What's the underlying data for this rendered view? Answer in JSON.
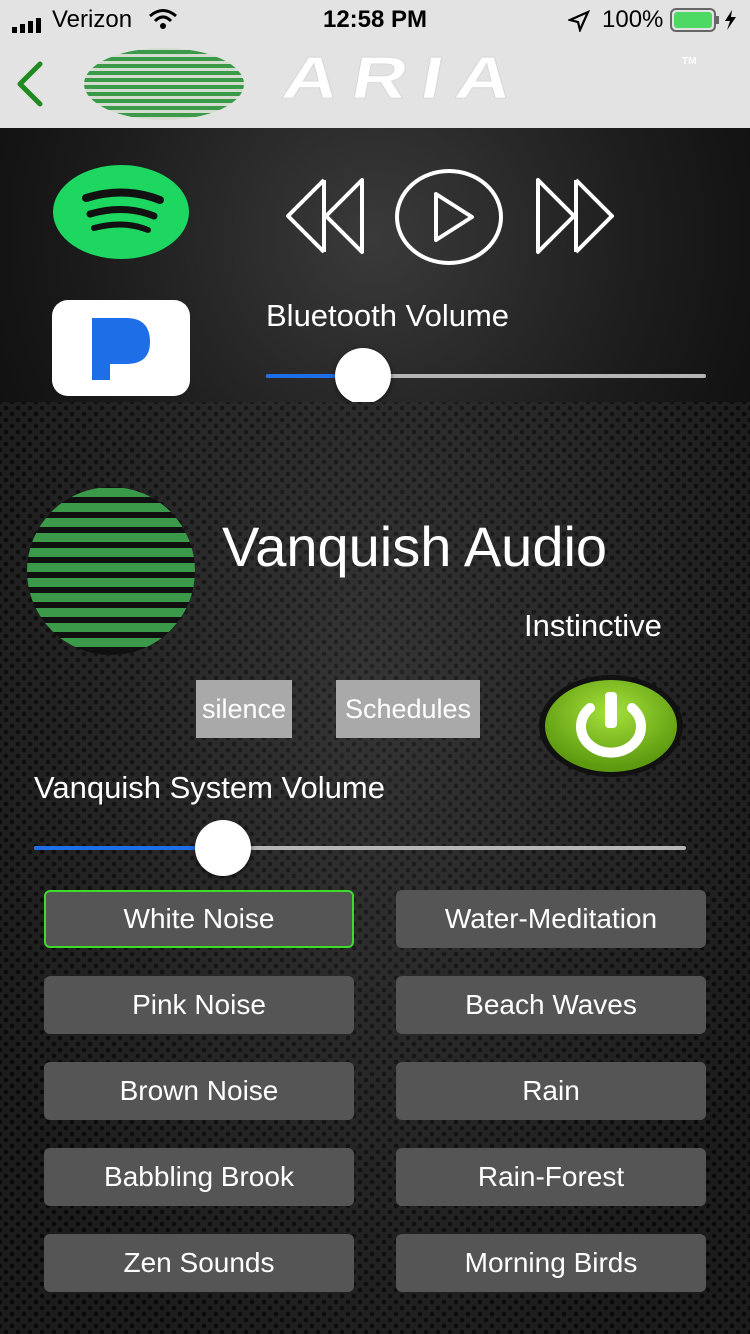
{
  "status_bar": {
    "carrier": "Verizon",
    "time": "12:58 PM",
    "battery": "100%"
  },
  "header": {
    "brand": "ARIA",
    "tm": "TM"
  },
  "media": {
    "bluetooth_volume_label": "Bluetooth Volume",
    "bluetooth_volume_level": 0.22
  },
  "device": {
    "name": "Vanquish Audio",
    "mode": "Instinctive",
    "silence_label": "silence",
    "schedules_label": "Schedules",
    "system_volume_label": "Vanquish System Volume",
    "system_volume_level": 0.29
  },
  "sounds": {
    "left": [
      "White Noise",
      "Pink Noise",
      "Brown Noise",
      "Babbling Brook",
      "Zen Sounds"
    ],
    "right": [
      "Water-Meditation",
      "Beach Waves",
      "Rain",
      "Rain-Forest",
      "Morning Birds"
    ],
    "selected": "White Noise"
  },
  "colors": {
    "accent_green": "#3bdc2a",
    "slider_blue": "#1e6ee8",
    "spotify_green": "#1ed760",
    "pandora_blue": "#1e6ee8",
    "power_green": "#7fbf1e"
  }
}
